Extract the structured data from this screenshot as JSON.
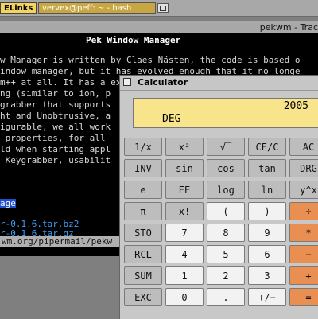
{
  "taskbar": {
    "elinks_label": "ELinks",
    "bash_label": "vervex@peff: ~ - bash"
  },
  "terminal": {
    "title": "pekwm - Trac",
    "heading": "Pek Window Manager",
    "lines": [
      "w Manager is written by Claes Nästen, the code is based o",
      "indow manager, but it has evolved enough that it no longe",
      "m++ at all. It has a extended feature-set, including",
      "ng (similar to ion, p  ...       autoproperties,",
      "grabber that supports",
      "",
      "ht and Unobtrusive, a",
      "igurable, we all work",
      " properties, for all",
      "ld when starting appl",
      " Keygrabber, usabilit"
    ],
    "link_selected": "age",
    "link1": "r-0.1.6.tar.bz2",
    "link2": "r-0.1.6.tar.gz",
    "status": "wm.org/pipermail/pekw"
  },
  "calculator": {
    "title": "Calculator",
    "display_value": "2005",
    "display_mode": "DEG",
    "buttons": [
      [
        "1/x",
        "x²",
        "√‾",
        "CE/C",
        "AC"
      ],
      [
        "INV",
        "sin",
        "cos",
        "tan",
        "DRG"
      ],
      [
        "e",
        "EE",
        "log",
        "ln",
        "y^x"
      ],
      [
        "π",
        "x!",
        "(",
        ")",
        "÷"
      ],
      [
        "STO",
        "7",
        "8",
        "9",
        "*"
      ],
      [
        "RCL",
        "4",
        "5",
        "6",
        "−"
      ],
      [
        "SUM",
        "1",
        "2",
        "3",
        "+"
      ],
      [
        "EXC",
        "0",
        ".",
        "+/−",
        "="
      ]
    ]
  },
  "colors": {
    "display_bg": "#f8e48a",
    "operator_button": "#e98f52",
    "number_button": "#f2f2f2",
    "function_button": "#bdbdbd",
    "link": "#3d9cf0"
  }
}
